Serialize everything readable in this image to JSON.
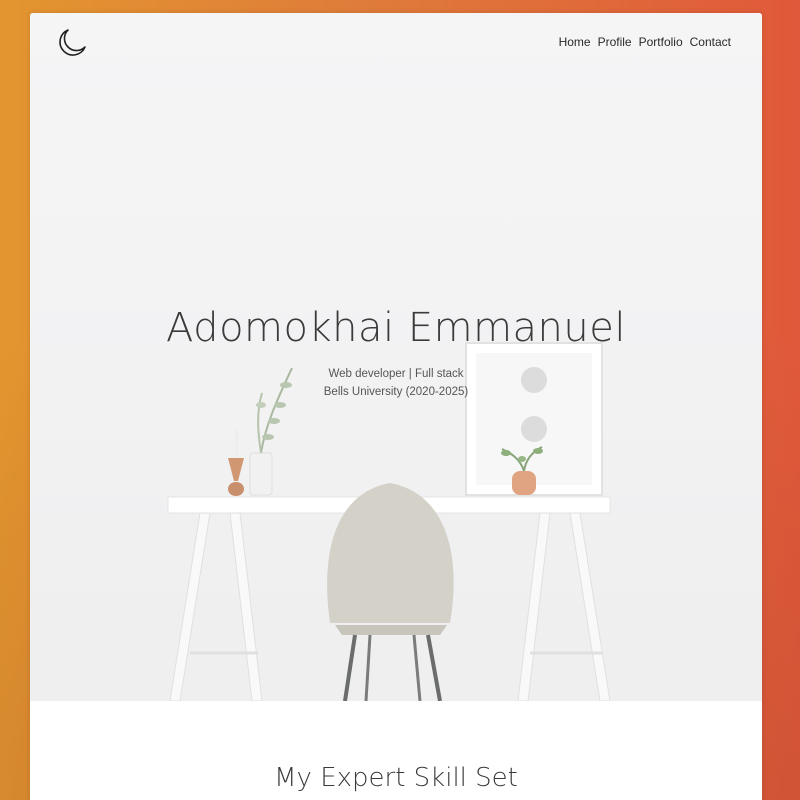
{
  "nav": {
    "items": [
      {
        "label": "Home"
      },
      {
        "label": "Profile"
      },
      {
        "label": "Portfolio"
      },
      {
        "label": "Contact"
      }
    ]
  },
  "hero": {
    "name": "Adomokhai Emmanuel",
    "role": "Web developer | Full stack",
    "education": "Bells University (2020-2025)"
  },
  "skills": {
    "title": "My Expert Skill Set"
  },
  "icons": {
    "logo": "moon-icon"
  },
  "colors": {
    "background_left": "#e3962f",
    "background_right": "#e0593a",
    "card": "#ffffff",
    "text": "#3a3a3a"
  }
}
